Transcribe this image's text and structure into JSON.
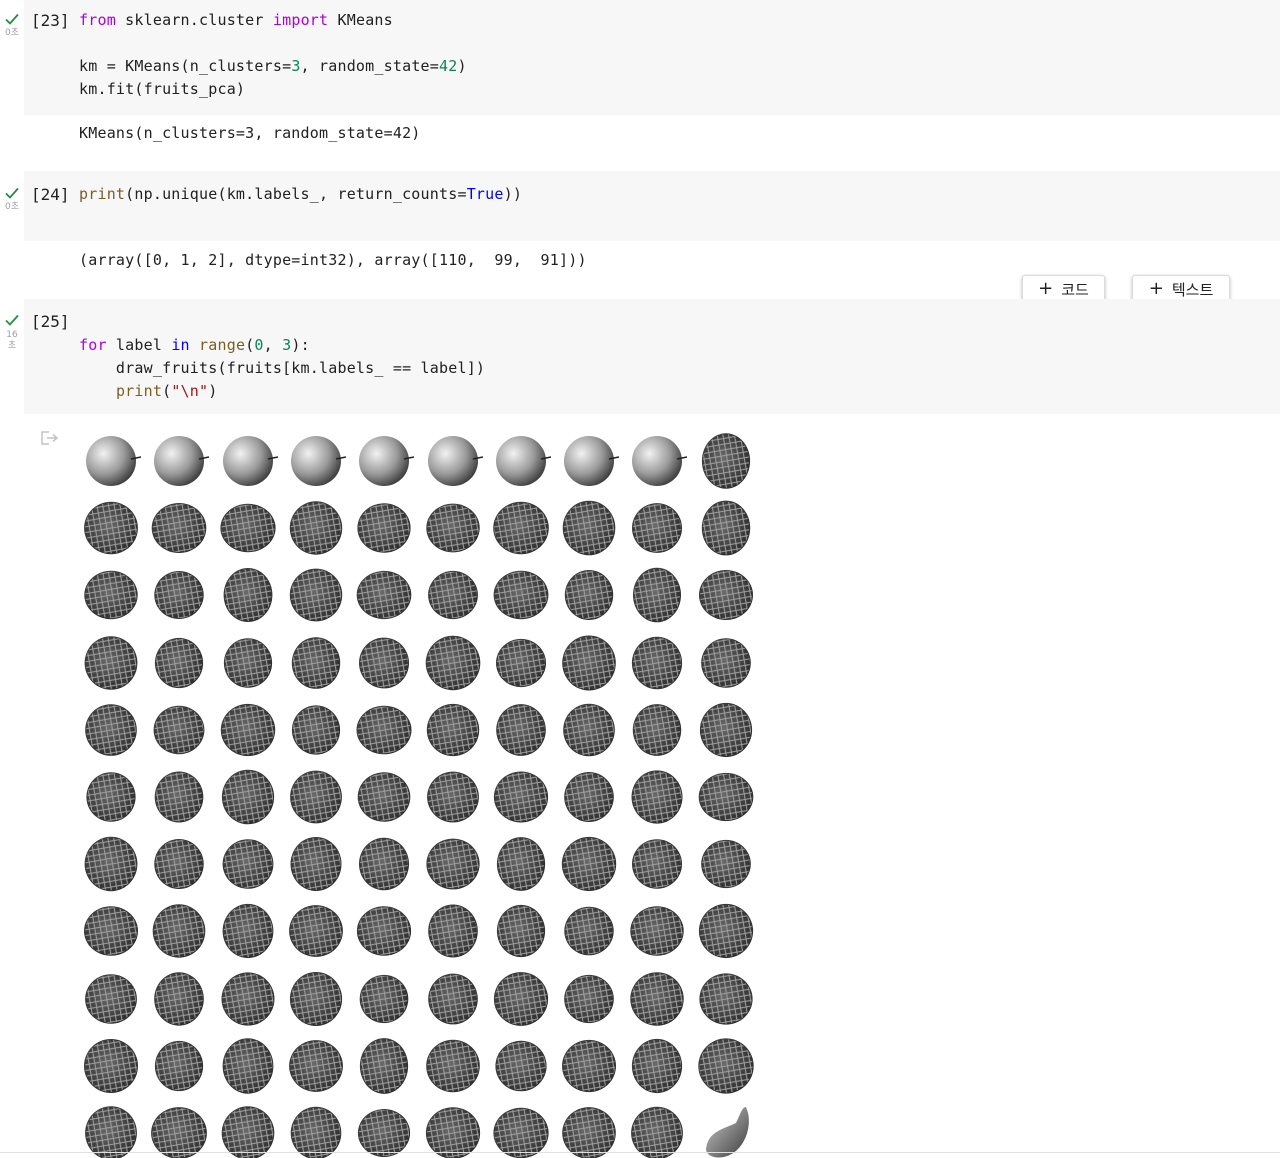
{
  "cells": [
    {
      "exec_count": "[23]",
      "runtime": "0초",
      "code_lines": [
        [
          {
            "t": "from",
            "c": "kw"
          },
          {
            "t": " sklearn.cluster ",
            "c": ""
          },
          {
            "t": "import",
            "c": "kw"
          },
          {
            "t": " KMeans",
            "c": ""
          }
        ],
        [],
        [
          {
            "t": "km = KMeans(n_clusters=",
            "c": ""
          },
          {
            "t": "3",
            "c": "num"
          },
          {
            "t": ", random_state=",
            "c": ""
          },
          {
            "t": "42",
            "c": "num"
          },
          {
            "t": ")",
            "c": ""
          }
        ],
        [
          {
            "t": "km.fit(fruits_pca)",
            "c": ""
          }
        ]
      ],
      "output": "KMeans(n_clusters=3, random_state=42)"
    },
    {
      "exec_count": "[24]",
      "runtime": "0초",
      "code_lines": [
        [
          {
            "t": "print",
            "c": "fn"
          },
          {
            "t": "(np.unique(km.labels_, return_counts=",
            "c": ""
          },
          {
            "t": "True",
            "c": "kw2"
          },
          {
            "t": "))",
            "c": ""
          }
        ]
      ],
      "output": "(array([0, 1, 2], dtype=int32), array([110,  99,  91]))"
    },
    {
      "exec_count": "[25]",
      "runtime": "16\n초",
      "code_lines": [
        [
          {
            "t": "for",
            "c": "kw"
          },
          {
            "t": " label ",
            "c": ""
          },
          {
            "t": "in",
            "c": "kw2"
          },
          {
            "t": " ",
            "c": ""
          },
          {
            "t": "range",
            "c": "fn"
          },
          {
            "t": "(",
            "c": ""
          },
          {
            "t": "0",
            "c": "num"
          },
          {
            "t": ", ",
            "c": ""
          },
          {
            "t": "3",
            "c": "num"
          },
          {
            "t": "):",
            "c": ""
          }
        ],
        [
          {
            "t": "    draw_fruits(fruits[km.labels_ == label])",
            "c": ""
          }
        ],
        [
          {
            "t": "    ",
            "c": ""
          },
          {
            "t": "print",
            "c": "fn"
          },
          {
            "t": "(",
            "c": ""
          },
          {
            "t": "\"\\n\"",
            "c": "str"
          },
          {
            "t": ")",
            "c": ""
          }
        ]
      ]
    }
  ],
  "toolbar": {
    "add_code_label": "코드",
    "add_text_label": "텍스트",
    "plus": "+"
  },
  "image_grid": {
    "columns": 10,
    "rows_visible": 11,
    "cells": [
      "apple",
      "apple",
      "apple",
      "apple",
      "apple",
      "apple",
      "apple",
      "apple",
      "apple",
      "pineapple",
      "pineapple",
      "pineapple",
      "pineapple",
      "pineapple",
      "pineapple",
      "pineapple",
      "pineapple",
      "pineapple",
      "pineapple",
      "pineapple",
      "pineapple",
      "pineapple",
      "pineapple",
      "pineapple",
      "pineapple",
      "pineapple",
      "pineapple",
      "pineapple",
      "pineapple",
      "pineapple",
      "pineapple",
      "pineapple",
      "pineapple",
      "pineapple",
      "pineapple",
      "pineapple",
      "pineapple",
      "pineapple",
      "pineapple",
      "pineapple",
      "pineapple",
      "pineapple",
      "pineapple",
      "pineapple",
      "pineapple",
      "pineapple",
      "pineapple",
      "pineapple",
      "pineapple",
      "pineapple",
      "pineapple",
      "pineapple",
      "pineapple",
      "pineapple",
      "pineapple",
      "pineapple",
      "pineapple",
      "pineapple",
      "pineapple",
      "pineapple",
      "pineapple",
      "pineapple",
      "pineapple",
      "pineapple",
      "pineapple",
      "pineapple",
      "pineapple",
      "pineapple",
      "pineapple",
      "pineapple",
      "pineapple",
      "pineapple",
      "pineapple",
      "pineapple",
      "pineapple",
      "pineapple",
      "pineapple",
      "pineapple",
      "pineapple",
      "pineapple",
      "pineapple",
      "pineapple",
      "pineapple",
      "pineapple",
      "pineapple",
      "pineapple",
      "pineapple",
      "pineapple",
      "pineapple",
      "pineapple",
      "pineapple",
      "pineapple",
      "pineapple",
      "pineapple",
      "pineapple",
      "pineapple",
      "pineapple",
      "pineapple",
      "pineapple",
      "pineapple",
      "pineapple",
      "pineapple",
      "pineapple",
      "pineapple",
      "pineapple",
      "pineapple",
      "pineapple",
      "pineapple",
      "pineapple",
      "banana"
    ]
  },
  "colors": {
    "check": "#1e8e3e",
    "cell_bg": "#f7f7f7",
    "keyword": "#af00db",
    "keyword_blue": "#0000ff",
    "function": "#795e26",
    "number": "#098658",
    "string": "#a31515"
  }
}
